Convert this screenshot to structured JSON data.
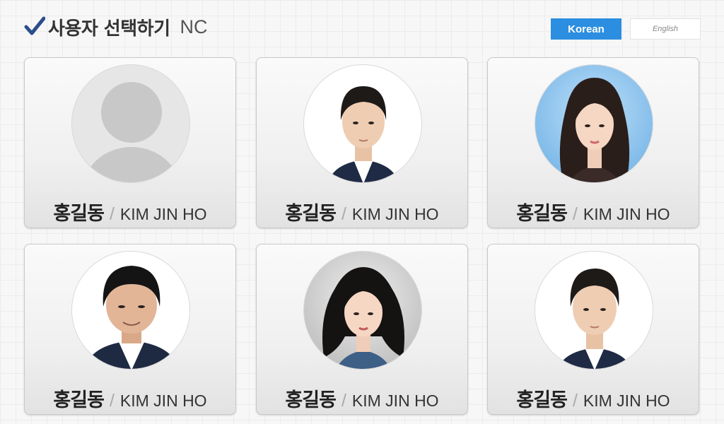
{
  "header": {
    "title": "사용자 선택하기",
    "subtitle": "NC",
    "check_icon": "checkmark-icon"
  },
  "language": {
    "korean": "Korean",
    "english": "English",
    "active": "Korean"
  },
  "users": [
    {
      "name_ko": "홍길동",
      "separator": "/",
      "name_en": "KIM JIN HO",
      "photo": "default-avatar-icon"
    },
    {
      "name_ko": "홍길동",
      "separator": "/",
      "name_en": "KIM JIN HO",
      "photo": "profile-photo"
    },
    {
      "name_ko": "홍길동",
      "separator": "/",
      "name_en": "KIM JIN HO",
      "photo": "profile-photo"
    },
    {
      "name_ko": "홍길동",
      "separator": "/",
      "name_en": "KIM JIN HO",
      "photo": "profile-photo"
    },
    {
      "name_ko": "홍길동",
      "separator": "/",
      "name_en": "KIM JIN HO",
      "photo": "profile-photo"
    },
    {
      "name_ko": "홍길동",
      "separator": "/",
      "name_en": "KIM JIN HO",
      "photo": "profile-photo"
    }
  ],
  "colors": {
    "accent": "#2b8ee0",
    "check": "#2b4e8c"
  }
}
